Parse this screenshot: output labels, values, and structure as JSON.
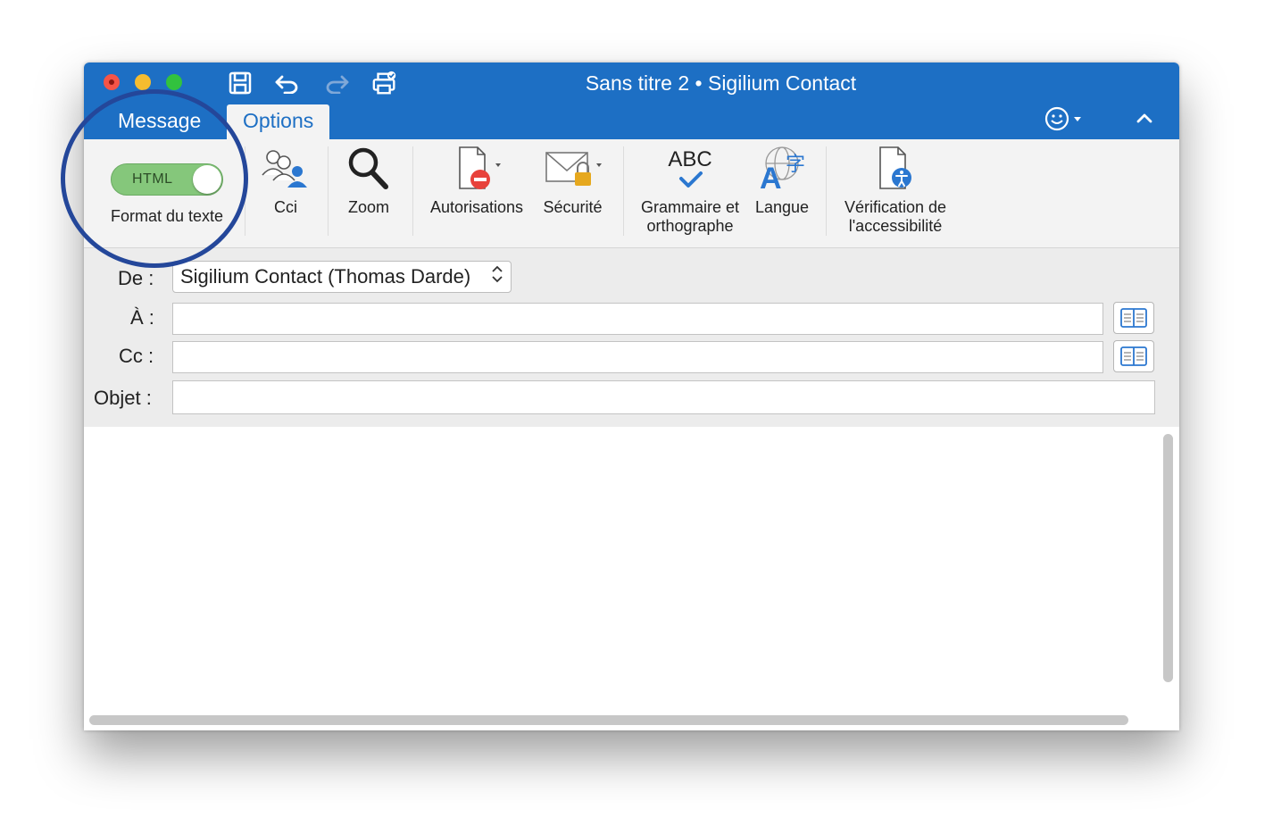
{
  "window": {
    "title": "Sans titre 2 • Sigilium Contact",
    "tabs": [
      {
        "label": "Message",
        "active": false
      },
      {
        "label": "Options",
        "active": true
      }
    ]
  },
  "ribbon": {
    "format_toggle": {
      "value": "HTML",
      "label": "Format du texte"
    },
    "cci": "Cci",
    "zoom": "Zoom",
    "autorisations": "Autorisations",
    "securite": "Sécurité",
    "grammaire_line1": "Grammaire et",
    "grammaire_line2": "orthographe",
    "grammaire_icon_text": "ABC",
    "langue": "Langue",
    "verification_line1": "Vérification de",
    "verification_line2": "l'accessibilité"
  },
  "header": {
    "from_label": "De :",
    "from_value": "Sigilium Contact (Thomas Darde)",
    "to_label": "À :",
    "to_value": "",
    "cc_label": "Cc :",
    "cc_value": "",
    "subject_label": "Objet :",
    "subject_value": ""
  },
  "colors": {
    "accent": "#1d6fc4",
    "toggle_on": "#85c77b",
    "highlight_ring": "#24479a"
  }
}
